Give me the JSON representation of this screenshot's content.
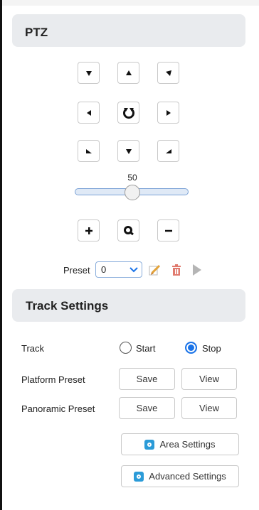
{
  "ptz": {
    "title": "PTZ",
    "speed_value": "50",
    "speed_level": 50,
    "preset_label": "Preset",
    "preset_value": "0"
  },
  "track_settings": {
    "title": "Track Settings",
    "track_label": "Track",
    "start_label": "Start",
    "stop_label": "Stop",
    "selected": "Stop",
    "platform_preset_label": "Platform Preset",
    "panoramic_preset_label": "Panoramic Preset",
    "save_label": "Save",
    "view_label": "View",
    "area_settings_label": "Area Settings",
    "advanced_settings_label": "Advanced Settings"
  },
  "colors": {
    "accent": "#1a73e8",
    "header_bg": "#e9ebee",
    "settings_icon": "#2b9bd8",
    "delete_icon": "#e07a6e"
  },
  "icons": [
    "arrow-down-right-icon",
    "arrow-up-icon",
    "arrow-down-left-icon",
    "arrow-left-icon",
    "reset-icon",
    "arrow-right-icon",
    "arrow-up-right-icon",
    "arrow-down-icon",
    "arrow-up-left-icon",
    "zoom-in-icon",
    "zoom-icon",
    "zoom-out-icon",
    "edit-icon",
    "delete-icon",
    "play-icon",
    "settings-icon"
  ]
}
